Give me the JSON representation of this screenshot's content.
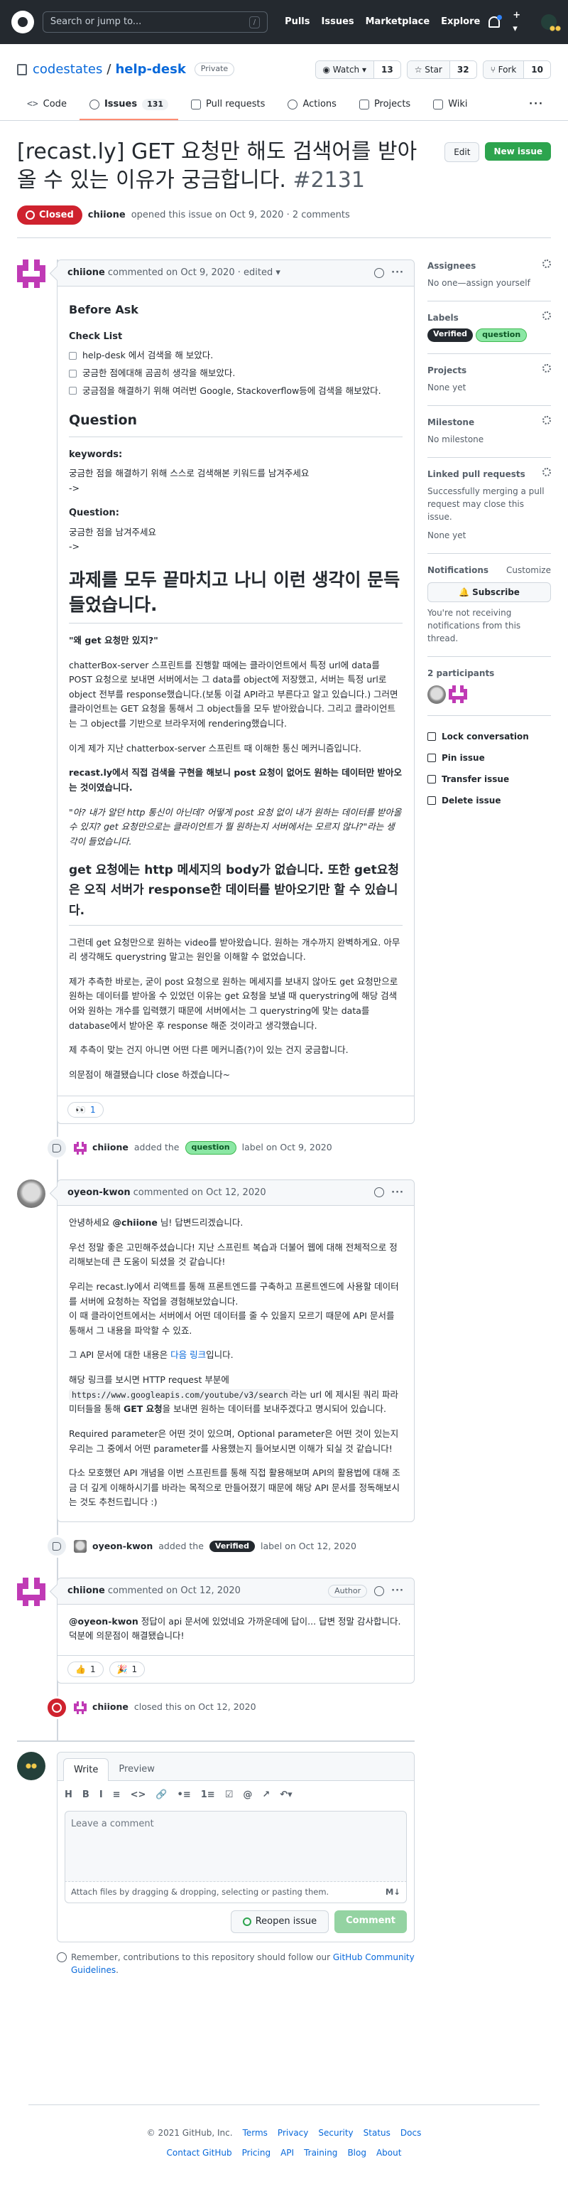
{
  "header": {
    "search_placeholder": "Search or jump to...",
    "slash": "/",
    "nav": [
      "Pulls",
      "Issues",
      "Marketplace",
      "Explore"
    ],
    "plus": "+ ▾"
  },
  "repo": {
    "owner": "codestates",
    "sep": "/",
    "name": "help-desk",
    "visibility": "Private",
    "watch_label": "◉ Watch ▾",
    "watch_count": "13",
    "star_label": "☆ Star",
    "star_count": "32",
    "fork_label": "⑂ Fork",
    "fork_count": "10"
  },
  "tabs": [
    {
      "label": "Code"
    },
    {
      "label": "Issues",
      "count": "131"
    },
    {
      "label": "Pull requests"
    },
    {
      "label": "Actions"
    },
    {
      "label": "Projects"
    },
    {
      "label": "Wiki"
    }
  ],
  "issue": {
    "title": "[recast.ly] GET 요청만 해도 검색어를 받아올 수 있는 이유가 궁금합니다.",
    "number": "#2131",
    "edit_label": "Edit",
    "new_label": "New issue",
    "state": "Closed",
    "author": "chiione",
    "opened": "opened this issue on Oct 9, 2020 · 2 comments"
  },
  "comment1": {
    "author": "chiione",
    "when": "commented on Oct 9, 2020 · edited ▾",
    "h_before": "Before Ask",
    "h_check": "Check List",
    "checks": [
      "help-desk 에서 검색을 해 보았다.",
      "궁금한 점에대해 곰곰히 생각을 해보았다.",
      "궁금점을 해결하기 위해 여러번 Google, Stackoverflow등에 검색을 해보았다."
    ],
    "h_question": "Question",
    "kw_label": "keywords:",
    "kw_text": "궁금한 점을 해결하기 위해 스스로 검색해본 키워드를 남겨주세요",
    "arrow": "->",
    "q_label": "Question:",
    "q_text": "궁금한 점을 남겨주세요",
    "h_big": "과제를 모두 끝마치고 나니 이런 생각이 문득 들었습니다.",
    "quote_title": "\"왜 get 요청만 있지?\"",
    "p1": "chatterBox-server 스프린트를 진행할 때에는 클라이언트에서 특정 url에 data를 POST 요청으로 보내면 서버에서는 그 data를 object에 저장했고, 서버는 특정 url로 object 전부를 response했습니다.(보통 이걸 API라고 부른다고 알고 있습니다.) 그러면 클라이언트는 GET 요청을 통해서 그 object들을 모두 받아왔습니다. 그리고 클라이언트는 그 object를 기반으로 브라우저에 rendering했습니다.",
    "p2": "이게 제가 지난 chatterbox-server 스프린트 때 이해한 통신 메커니즘입니다.",
    "p3": "recast.ly에서 직접 검색을 구현을 해보니 post 요청이 없어도 원하는 데이터만 받아오는 것이였습니다.",
    "p4": "\"아? 내가 알던 http 통신이 아닌데? 어떻게 post 요청 없이 내가 원하는 데이터를 받아올 수 있지? get 요청만으로는 클라이언트가 뭘 원하는지 서버에서는 모르지 않나?\"라는 생각이 들었습니다.",
    "h2b": "get 요청에는 http 메세지의 body가 없습니다. 또한 get요청은 오직 서버가 response한 데이터를 받아오기만 할 수 있습니다.",
    "p5": "그런데 get 요청만으로 원하는 video를 받아왔습니다. 원하는 개수까지 완벽하게요. 아무리 생각해도 querystring 말고는 원인을 이해할 수 없었습니다.",
    "p6": "제가 추측한 바로는, 굳이 post 요청으로 원하는 메세지를 보내지 않아도 get 요청만으로 원하는 데이터를 받아올 수 있었던 이유는 get 요청을 보낼 때 querystring에 해당 검색어와 원하는 개수를 입력했기 때문에 서버에서는 그 querystring에 맞는 data를 database에서 받아온 후 response 해준 것이라고 생각했습니다.",
    "p7": "제 추측이 맞는 건지 아니면 어떤 다른 메커니즘(?)이 있는 건지 궁금합니다.",
    "p8": "의문점이 해결됐습니다 close 하겠습니다~",
    "react_emoji": "👀",
    "react_count": "1"
  },
  "event1": {
    "user": "chiione",
    "action": "added the",
    "label": "question",
    "suffix": "label on Oct 9, 2020"
  },
  "comment2": {
    "author": "oyeon-kwon",
    "when": "commented on Oct 12, 2020",
    "p1a": "안녕하세요",
    "mention": "@chiione",
    "p1b": "님! 답변드리겠습니다.",
    "p2": "우선 정말 좋은 고민해주셨습니다! 지난 스프린트 복습과 더불어 웹에 대해 전체적으로 정리해보는데 큰 도움이 되셨을 것 같습니다!",
    "p3": "우리는 recast.ly에서 리액트를 통해 프론트엔드를 구축하고 프론트엔드에 사용할 데이터를 서버에 요청하는 작업을 경험해보았습니다.",
    "p3b": "이 때 클라이언트에서는 서버에서 어떤 데이터를 줄 수 있을지 모르기 때문에 API 문서를 통해서 그 내용을 파악할 수 있죠.",
    "p4a": "그 API 문서에 대한 내용은",
    "p4link": "다음 링크",
    "p4b": "입니다.",
    "p5a": "해당 링크를 보시면 HTTP request 부분에",
    "p5code": "https://www.googleapis.com/youtube/v3/search",
    "p5b": "라는 url 에 제시된 쿼리 파라미터들을 통해",
    "p5bold": "GET 요청",
    "p5c": "을 보내면 원하는 데이터를 보내주겠다고 명시되어 있습니다.",
    "p6": "Required parameter은 어떤 것이 있으며, Optional parameter은 어떤 것이 있는지 우리는 그 중에서 어떤 parameter를 사용했는지 들어보시면 이해가 되실 것 같습니다!",
    "p7": "다소 모호했던 API 개념을 이번 스프린트를 통해 직접 활용해보며 API의 활용법에 대해 조금 더 깊게 이해하시기를 바라는 목적으로 만들어졌기 때문에 해당 API 문서를 정독해보시는 것도 추천드립니다 :)"
  },
  "event2": {
    "user": "oyeon-kwon",
    "action": "added the",
    "label": "Verified",
    "suffix": "label on Oct 12, 2020"
  },
  "comment3": {
    "author": "chiione",
    "when": "commented on Oct 12, 2020",
    "badge": "Author",
    "mention": "@oyeon-kwon",
    "text": "정답이 api 문서에 있었네요 가까운데에 답이... 답변 정말 감사합니다. 덕분에 의문점이 해결됐습니다!",
    "r1e": "👍",
    "r1c": "1",
    "r2e": "🎉",
    "r2c": "1"
  },
  "event3": {
    "user": "chiione",
    "text": "closed this on Oct 12, 2020"
  },
  "composer": {
    "write": "Write",
    "preview": "Preview",
    "tools": [
      "H",
      "B",
      "I",
      "≡",
      "<>",
      "🔗",
      "•≡",
      "1≡",
      "☑",
      "@",
      "↗",
      "↶▾"
    ],
    "placeholder": "Leave a comment",
    "attach": "Attach files by dragging & dropping, selecting or pasting them.",
    "md": "M↓",
    "reopen": "Reopen issue",
    "comment": "Comment"
  },
  "remember": {
    "text": "Remember, contributions to this repository should follow our",
    "link": "GitHub Community Guidelines",
    "end": "."
  },
  "sidebar": {
    "assignees": "Assignees",
    "assignees_val": "No one—assign yourself",
    "labels": "Labels",
    "label_items": [
      "Verified",
      "question"
    ],
    "projects": "Projects",
    "projects_val": "None yet",
    "milestone": "Milestone",
    "milestone_val": "No milestone",
    "linked": "Linked pull requests",
    "linked_desc": "Successfully merging a pull request may close this issue.",
    "linked_val": "None yet",
    "notif": "Notifications",
    "customize": "Customize",
    "subscribe": "🔔 Subscribe",
    "notif_desc": "You're not receiving notifications from this thread.",
    "participants": "2 participants",
    "lock": "Lock conversation",
    "pin": "Pin issue",
    "transfer": "Transfer issue",
    "delete": "Delete issue"
  },
  "footer": {
    "copy": "© 2021 GitHub, Inc.",
    "row1": [
      "Terms",
      "Privacy",
      "Security",
      "Status",
      "Docs"
    ],
    "row2": [
      "Contact GitHub",
      "Pricing",
      "API",
      "Training",
      "Blog",
      "About"
    ]
  },
  "colors": {
    "closed": "#cf222e",
    "green": "#2da44e",
    "link": "#0969da"
  }
}
